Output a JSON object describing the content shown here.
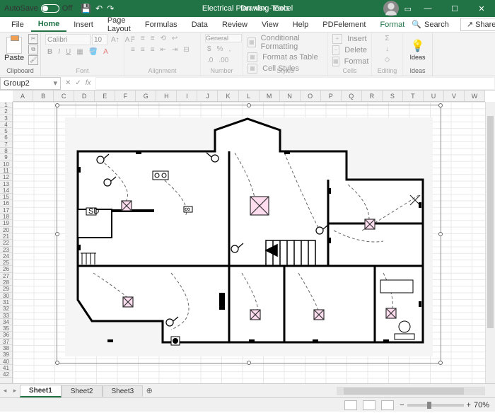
{
  "titlebar": {
    "autosave_label": "AutoSave",
    "autosave_state": "Off",
    "document_name": "Electrical Plan.xlsx - Excel",
    "context_tab": "Drawing Tools"
  },
  "menu": {
    "file": "File",
    "home": "Home",
    "insert": "Insert",
    "page_layout": "Page Layout",
    "formulas": "Formulas",
    "data": "Data",
    "review": "Review",
    "view": "View",
    "help": "Help",
    "pdfelement": "PDFelement",
    "format": "Format",
    "search": "Search",
    "share": "Share"
  },
  "ribbon": {
    "clipboard": {
      "label": "Clipboard",
      "paste": "Paste"
    },
    "font": {
      "label": "Font",
      "name": "Calibri",
      "size": "10",
      "bold": "B",
      "italic": "I",
      "underline": "U"
    },
    "alignment": {
      "label": "Alignment"
    },
    "number": {
      "label": "Number",
      "format": "General"
    },
    "styles": {
      "label": "Styles",
      "conditional": "Conditional Formatting",
      "table": "Format as Table",
      "cell": "Cell Styles"
    },
    "cells": {
      "label": "Cells",
      "insert": "Insert",
      "delete": "Delete",
      "format": "Format"
    },
    "editing": {
      "label": "Editing"
    },
    "ideas": {
      "label": "Ideas",
      "btn": "Ideas"
    }
  },
  "namebox": "Group2",
  "columns": [
    "A",
    "B",
    "C",
    "D",
    "E",
    "F",
    "G",
    "H",
    "I",
    "J",
    "K",
    "L",
    "M",
    "N",
    "O",
    "P",
    "Q",
    "R",
    "S",
    "T",
    "U",
    "V",
    "W"
  ],
  "rows": [
    "1",
    "2",
    "3",
    "4",
    "5",
    "6",
    "7",
    "8",
    "9",
    "10",
    "11",
    "12",
    "13",
    "14",
    "15",
    "16",
    "17",
    "18",
    "19",
    "20",
    "21",
    "22",
    "23",
    "24",
    "25",
    "26",
    "27",
    "28",
    "29",
    "30",
    "31",
    "32",
    "33",
    "34",
    "35",
    "36",
    "37",
    "38",
    "39",
    "40",
    "41",
    "42"
  ],
  "sheets": {
    "s1": "Sheet1",
    "s2": "Sheet2",
    "s3": "Sheet3"
  },
  "zoom": "70%",
  "floorplan_label": "SD"
}
